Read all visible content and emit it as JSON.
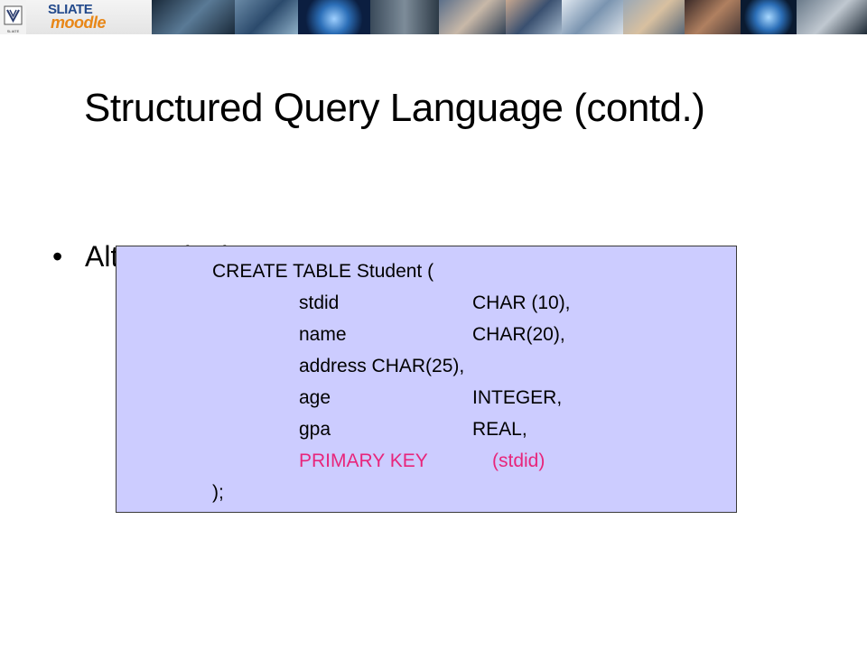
{
  "banner": {
    "logo_caption": "SLIATE",
    "brand_line1": "SLIATE",
    "brand_line2": "moodle"
  },
  "slide": {
    "title": "Structured Query Language (contd.)",
    "bullet_marker": "•",
    "bullet_text": "Alternatively"
  },
  "code": {
    "open": "CREATE TABLE Student (",
    "fields": [
      {
        "name": "stdid",
        "type": "CHAR (10),"
      },
      {
        "name": "name",
        "type": "CHAR(20),"
      },
      {
        "name": "address CHAR(25),",
        "type": ""
      },
      {
        "name": "age",
        "type": "INTEGER,"
      },
      {
        "name": "gpa",
        "type": "REAL,"
      }
    ],
    "pk_keyword": "PRIMARY KEY",
    "pk_column": "(stdid)",
    "close": ");"
  },
  "colors": {
    "code_background": "#ccccff",
    "primary_key_text": "#e8257b",
    "brand_blue": "#234a8c",
    "brand_orange": "#e88718"
  }
}
